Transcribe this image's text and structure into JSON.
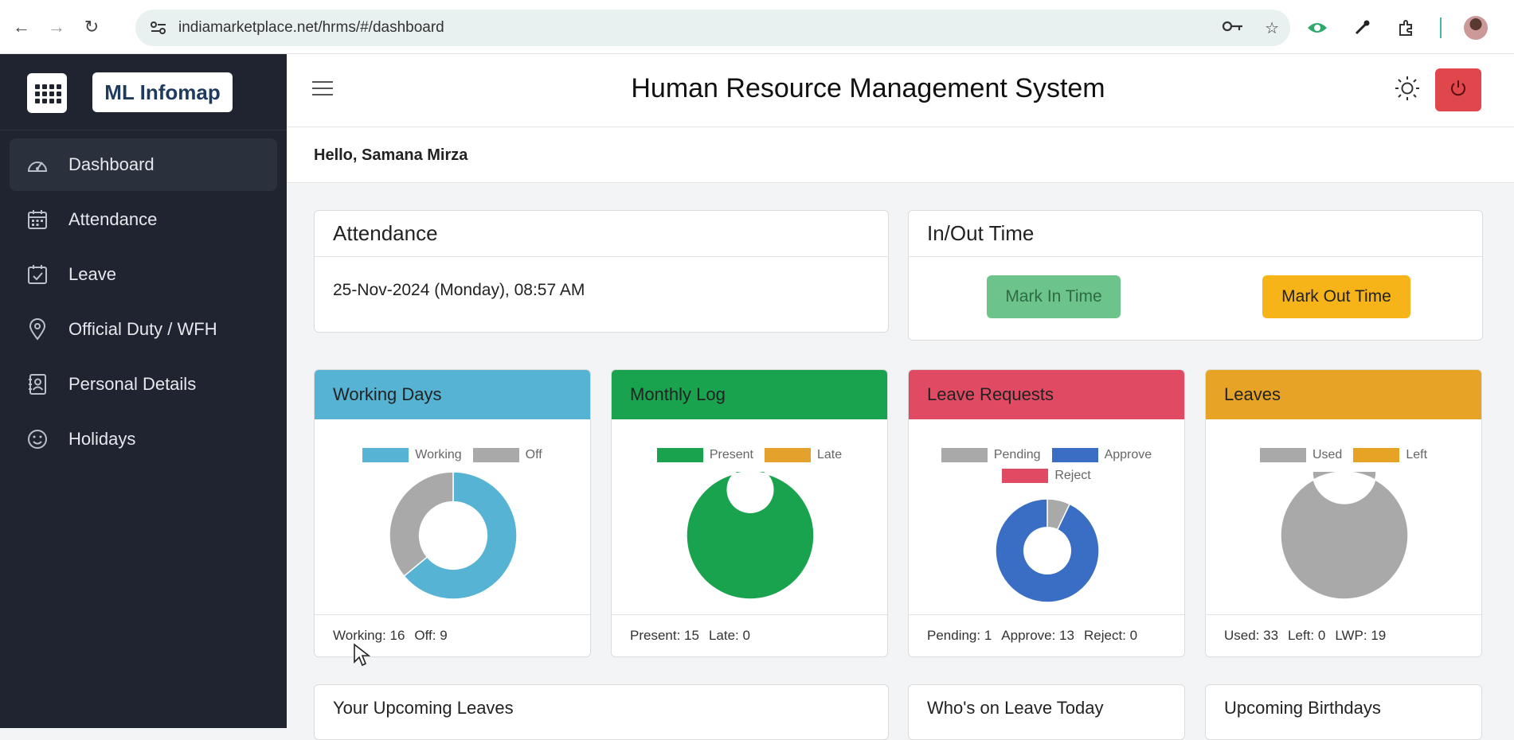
{
  "browser": {
    "url": "indiamarketplace.net/hrms/#/dashboard"
  },
  "sidebar": {
    "brand": "ML Infomap",
    "items": [
      {
        "label": "Dashboard",
        "icon": "dashboard-gauge-icon",
        "active": true
      },
      {
        "label": "Attendance",
        "icon": "calendar-icon",
        "active": false
      },
      {
        "label": "Leave",
        "icon": "calendar-check-icon",
        "active": false
      },
      {
        "label": "Official Duty / WFH",
        "icon": "location-pin-icon",
        "active": false
      },
      {
        "label": "Personal Details",
        "icon": "contact-card-icon",
        "active": false
      },
      {
        "label": "Holidays",
        "icon": "smiley-icon",
        "active": false
      }
    ]
  },
  "header": {
    "title": "Human Resource Management System",
    "greeting": "Hello, Samana Mirza"
  },
  "attendance": {
    "title": "Attendance",
    "datetime": "25-Nov-2024 (Monday), 08:57 AM"
  },
  "inout": {
    "title": "In/Out Time",
    "mark_in": "Mark In Time",
    "mark_out": "Mark Out Time"
  },
  "stats": [
    {
      "title": "Working Days",
      "header_color": "#56b3d3",
      "legend": [
        {
          "label": "Working",
          "color": "#56b3d3"
        },
        {
          "label": "Off",
          "color": "#a9a9a9"
        }
      ],
      "slices": [
        {
          "value": 16,
          "color": "#56b3d3"
        },
        {
          "value": 9,
          "color": "#a9a9a9"
        }
      ],
      "footer": [
        "Working: 16",
        "Off: 9"
      ],
      "hole": 0.53
    },
    {
      "title": "Monthly Log",
      "header_color": "#1aa34f",
      "legend": [
        {
          "label": "Present",
          "color": "#1aa34f"
        },
        {
          "label": "Late",
          "color": "#e4a22c"
        }
      ],
      "slices": [
        {
          "value": 15,
          "color": "#1aa34f"
        },
        {
          "value": 0,
          "color": "#e4a22c"
        }
      ],
      "footer": [
        "Present: 15",
        "Late: 0"
      ],
      "hole": 0.36
    },
    {
      "title": "Leave Requests",
      "header_color": "#e04b63",
      "legend": [
        {
          "label": "Pending",
          "color": "#a9a9a9"
        },
        {
          "label": "Approve",
          "color": "#3a6ec4"
        },
        {
          "label": "Reject",
          "color": "#e04b63"
        }
      ],
      "slices": [
        {
          "value": 1,
          "color": "#a9a9a9"
        },
        {
          "value": 13,
          "color": "#3a6ec4"
        },
        {
          "value": 0,
          "color": "#e04b63"
        }
      ],
      "footer": [
        "Pending: 1",
        "Approve: 13",
        "Reject: 0"
      ],
      "hole": 0.45
    },
    {
      "title": "Leaves",
      "header_color": "#e6a326",
      "legend": [
        {
          "label": "Used",
          "color": "#a9a9a9"
        },
        {
          "label": "Left",
          "color": "#e6a326"
        }
      ],
      "slices": [
        {
          "value": 33,
          "color": "#a9a9a9"
        },
        {
          "value": 0,
          "color": "#e6a326"
        }
      ],
      "footer": [
        "Used: 33",
        "Left: 0",
        "LWP: 19"
      ],
      "hole": 0.5
    }
  ],
  "bottom_cards": [
    "Your Upcoming Leaves",
    "Who's on Leave Today",
    "Upcoming Birthdays"
  ]
}
